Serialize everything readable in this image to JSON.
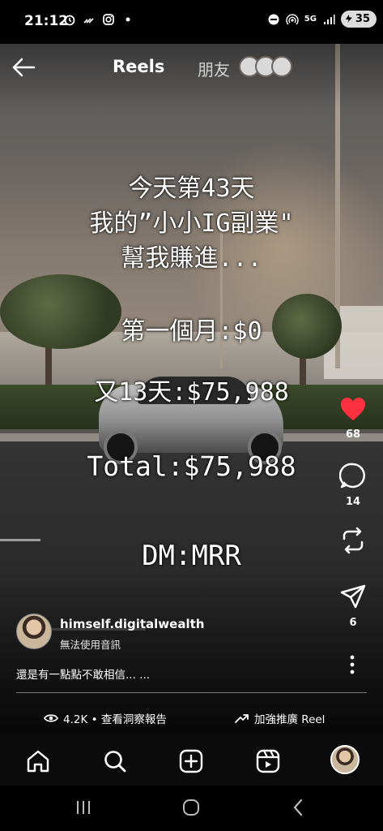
{
  "status_bar": {
    "time": "21:12",
    "network": "5G",
    "battery": "35"
  },
  "header": {
    "back_icon": "arrow-left-icon",
    "title": "Reels",
    "friends_label": "朋友"
  },
  "overlay_text": {
    "line1": "今天第43天",
    "line2": "我的”小小IG副業\"",
    "line3": "幫我賺進...",
    "line4": "第一個月:$0",
    "line5": "又13天:$75,988",
    "line6": "Total:$75,988",
    "line7": "DM:MRR"
  },
  "actions": {
    "like_count": "68",
    "comment_count": "14",
    "share_count": "6"
  },
  "author": {
    "username": "himself.digitalwealth",
    "audio": "無法使用音訊",
    "caption": "還是有一點點不敢相信... ..."
  },
  "stats": {
    "views": "4.2K • 查看洞察報告",
    "boost": "加強推廣 Reel"
  },
  "colors": {
    "like": "#ff3040",
    "background": "#000000"
  },
  "nav": {
    "items": [
      "home-icon",
      "search-icon",
      "create-icon",
      "reels-icon",
      "profile-avatar"
    ]
  }
}
